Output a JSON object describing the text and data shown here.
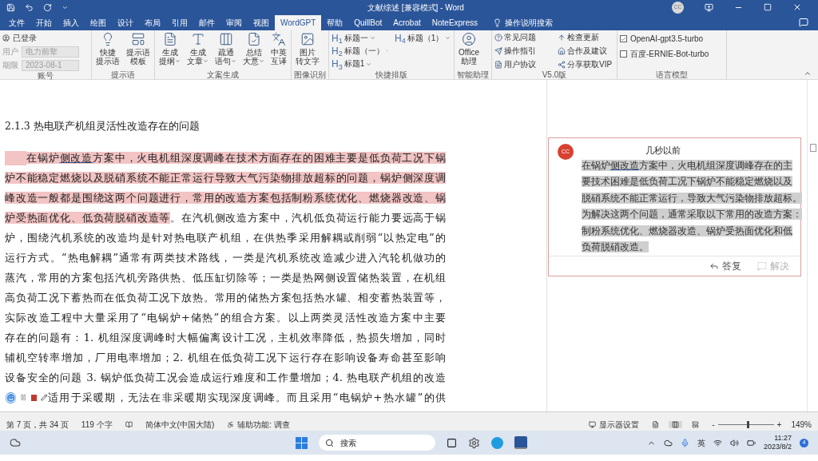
{
  "title_bar": {
    "title": "文献综述 [兼容模式] - Word",
    "account": "CC"
  },
  "tabs": [
    {
      "label": "文件",
      "selected": false
    },
    {
      "label": "开始",
      "selected": false
    },
    {
      "label": "插入",
      "selected": false
    },
    {
      "label": "绘图",
      "selected": false
    },
    {
      "label": "设计",
      "selected": false
    },
    {
      "label": "布局",
      "selected": false
    },
    {
      "label": "引用",
      "selected": false
    },
    {
      "label": "邮件",
      "selected": false
    },
    {
      "label": "审阅",
      "selected": false
    },
    {
      "label": "视图",
      "selected": false
    },
    {
      "label": "WordGPT",
      "selected": true
    },
    {
      "label": "帮助",
      "selected": false
    },
    {
      "label": "QuillBot",
      "selected": false
    },
    {
      "label": "Acrobat",
      "selected": false
    },
    {
      "label": "NoteExpress",
      "selected": false
    }
  ],
  "tell_me": "操作说明搜索",
  "ribbon": [
    {
      "kind": "account",
      "label": "账号",
      "status": "已登录",
      "fields": [
        {
          "label": "用户",
          "value": "电力前辈"
        },
        {
          "label": "期限",
          "value": "2023-08-1"
        }
      ]
    },
    {
      "kind": "large",
      "label": "提示语",
      "buttons": [
        {
          "lines": [
            "快捷",
            "提示语"
          ],
          "dropdown": false
        },
        {
          "lines": [
            "提示语",
            "模板"
          ],
          "dropdown": false
        }
      ]
    },
    {
      "kind": "large",
      "label": "文案生成",
      "buttons": [
        {
          "lines": [
            "生成",
            "提纲"
          ],
          "dropdown": true
        },
        {
          "lines": [
            "生成",
            "文章"
          ],
          "dropdown": true
        },
        {
          "lines": [
            "疏通",
            "语句"
          ],
          "dropdown": true
        },
        {
          "lines": [
            "总结",
            "大意"
          ],
          "dropdown": true
        },
        {
          "lines": [
            "中英",
            "互译"
          ],
          "dropdown": false
        }
      ]
    },
    {
      "kind": "large",
      "label": "图像识别",
      "buttons": [
        {
          "lines": [
            "图片",
            "转文字"
          ],
          "dropdown": false
        }
      ]
    },
    {
      "kind": "headings",
      "label": "快捷排版",
      "items": [
        {
          "mark": "H$_{1}$",
          "text": "标题一"
        },
        {
          "mark": "H$_{2}$",
          "text": "标题（一）"
        },
        {
          "mark": "H$_{3}$",
          "text": "标题1"
        },
        {
          "mark": "H$_{4}$",
          "text": "标题（1）"
        }
      ]
    },
    {
      "kind": "large",
      "label": "智能助理",
      "buttons": [
        {
          "lines": [
            "Office",
            "助理"
          ],
          "dropdown": false
        }
      ]
    },
    {
      "kind": "links",
      "label": "V5.0版",
      "items": [
        "常见问题",
        "检查更新",
        "操作指引",
        "合作及建议",
        "用户协议",
        "分享获取VIP"
      ]
    },
    {
      "kind": "models",
      "label": "语言模型",
      "items": [
        {
          "text": "OpenAI-gpt3.5-turbo",
          "checked": true
        },
        {
          "text": "百度-ERNIE-Bot-turbo",
          "checked": false
        }
      ]
    }
  ],
  "document": {
    "heading": "2.1.3  热电联产机组灵活性改造存在的问题",
    "lines": [
      {
        "indent": true,
        "segments": [
          {
            "text": "在锅炉",
            "highlighted": true
          },
          {
            "text": "侧改造",
            "highlighted": true,
            "underlined": true
          },
          {
            "text": "方案中，火电机组深度调峰在技术方面存在的困难主要是低负荷工况下锅",
            "highlighted": true
          }
        ]
      },
      {
        "indent": false,
        "segments": [
          {
            "text": "炉不能稳定燃烧以及脱硝系统不能正常运行导致大气污染物排放超标的问题，锅炉侧深度调",
            "highlighted": true
          }
        ]
      },
      {
        "indent": false,
        "segments": [
          {
            "text": "峰改造一般都是围绕这两个问题进行，常用的改造方案包括制粉系统优化、燃烧器改造、锅",
            "highlighted": true
          }
        ]
      },
      {
        "indent": false,
        "segments": [
          {
            "text": "炉受热面优化、低负荷脱硝改造等",
            "highlighted": true
          },
          {
            "text": "。在汽机侧改造方案中，汽机低负荷运行能力要远高于锅",
            "highlighted": false
          }
        ]
      },
      {
        "indent": false,
        "segments": [
          {
            "text": "炉，围绕汽机系统的改造均是针对热电联产机组，在供热季采用解耦或削弱“以热定电”的",
            "highlighted": false
          }
        ]
      },
      {
        "indent": false,
        "segments": [
          {
            "text": "运行方式。“热电解耦”通常有两类技术路线，一类是汽机系统改造减少进入汽轮机做功的",
            "highlighted": false
          }
        ]
      },
      {
        "indent": false,
        "segments": [
          {
            "text": "蒸汽，常用的方案包括汽机旁路供热、低压缸切除等；一类是热网侧设置储热装置，在机组",
            "highlighted": false
          }
        ]
      },
      {
        "indent": false,
        "segments": [
          {
            "text": "高负荷工况下蓄热而在低负荷工况下放热。常用的储热方案包括热水罐、相变蓄热装置等，",
            "highlighted": false
          }
        ]
      },
      {
        "indent": false,
        "segments": [
          {
            "text": "实际改造工程中大量采用了“电锅炉+储热”的组合方案。以上两类灵活性改造方案中主要",
            "highlighted": false
          }
        ]
      },
      {
        "indent": false,
        "segments": [
          {
            "text": "存在的问题有：1. 机组深度调峰时大幅偏离设计工况，主机效率降低，热损失增加，同时",
            "highlighted": false
          }
        ]
      },
      {
        "indent": false,
        "segments": [
          {
            "text": "辅机空转率增加，厂用电率增加；2. 机组在低负荷工况下运行存在影响设备寿命甚至影响",
            "highlighted": false
          }
        ]
      },
      {
        "indent": false,
        "segments": [
          {
            "text": "设备安全的问题 3. 锅炉低负荷工况会造成运行难度和工作量增加；4. 热电联产机组的改造",
            "highlighted": false
          }
        ]
      },
      {
        "indent": false,
        "segments": [
          {
            "text": "适用于采暖期，无法在非采暖期实现深度调峰。而且采用“电锅炉+热水罐”的供",
            "highlighted": false
          }
        ]
      }
    ]
  },
  "comment": {
    "avatar": "CC",
    "time": "几秒以前",
    "lines": [
      {
        "segments": [
          {
            "text": "在锅炉",
            "highlighted": true
          },
          {
            "text": "侧改造",
            "highlighted": true,
            "underlined": true
          },
          {
            "text": "方案中，火电机组深度调峰存在的主",
            "highlighted": true
          }
        ]
      },
      {
        "segments": [
          {
            "text": "要技术困难是低负荷工况下锅炉不能稳定燃烧以及",
            "highlighted": true
          }
        ]
      },
      {
        "segments": [
          {
            "text": "脱硝系统不能正常运行，导致大气污染物排放超标。",
            "highlighted": true
          }
        ]
      },
      {
        "segments": [
          {
            "text": "为解决这两个问题，通常采取以下常用的改造方案：",
            "highlighted": true
          }
        ]
      },
      {
        "segments": [
          {
            "text": "制粉系统优化、燃烧器改造、锅炉受热面优化和低",
            "highlighted": true
          }
        ]
      },
      {
        "segments": [
          {
            "text": "负荷脱硝改造。",
            "highlighted": true
          }
        ]
      }
    ],
    "actions": [
      {
        "label": "答复",
        "disabled": false
      },
      {
        "label": "解决",
        "disabled": true
      }
    ]
  },
  "status_bar": {
    "page": "第 7 页，共 34 页",
    "words": "119 个字",
    "language": "简体中文(中国大陆)",
    "accessibility": "辅助功能: 调查",
    "display": "显示器设置",
    "zoom_minus": "-",
    "zoom_plus": "+",
    "zoom": {
      "level": 0.52
    },
    "zoom_text": "149%"
  },
  "taskbar": {
    "search": "搜索",
    "ime": "英",
    "time": "11:27",
    "date": "2023/8/2",
    "badge": "4"
  }
}
